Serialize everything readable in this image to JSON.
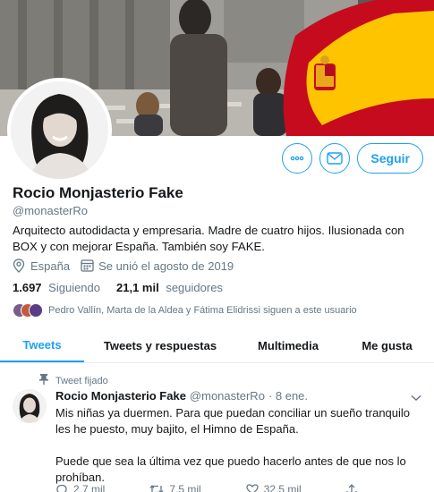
{
  "profile": {
    "name": "Rocio Monjasterio Fake",
    "handle": "@monasterRo",
    "bio": "Arquitecto autodidacta y empresaria. Madre de cuatro hijos. Ilusionada con BOX y con mejorar España. También soy FAKE.",
    "location": "España",
    "joined": "Se unió el agosto de 2019",
    "following_count": "1.697",
    "following_label": "Siguiendo",
    "followers_count": "21,1 mil",
    "followers_label": "seguidores",
    "followed_by": "Pedro Vallín, Marta de la Aldea y Fátima Elidrissi siguen a este usuario"
  },
  "actions": {
    "more_icon": "more-icon",
    "message_icon": "mail-icon",
    "follow_label": "Seguir"
  },
  "tabs": [
    {
      "label": "Tweets",
      "active": true
    },
    {
      "label": "Tweets y respuestas",
      "active": false
    },
    {
      "label": "Multimedia",
      "active": false
    },
    {
      "label": "Me gusta",
      "active": false
    }
  ],
  "pinned_tweet": {
    "pinned_label": "Tweet fijado",
    "author_name": "Rocio Monjasterio Fake",
    "author_handle": "@monasterRo",
    "date": "· 8 ene.",
    "paragraphs": [
      "Mis niñas ya duermen. Para que puedan conciliar un sueño tranquilo les he puesto, muy bajito, el Himno de España.",
      "Puede que sea la última vez que puedo hacerlo antes de que nos lo prohíban."
    ],
    "replies": "2,7 mil",
    "retweets": "7,5 mil",
    "likes": "32,5 mil"
  },
  "colors": {
    "accent": "#1da1f2",
    "text": "#14171a",
    "secondary": "#657786",
    "flag_red": "#c60b1e",
    "flag_yellow": "#ffc400"
  }
}
